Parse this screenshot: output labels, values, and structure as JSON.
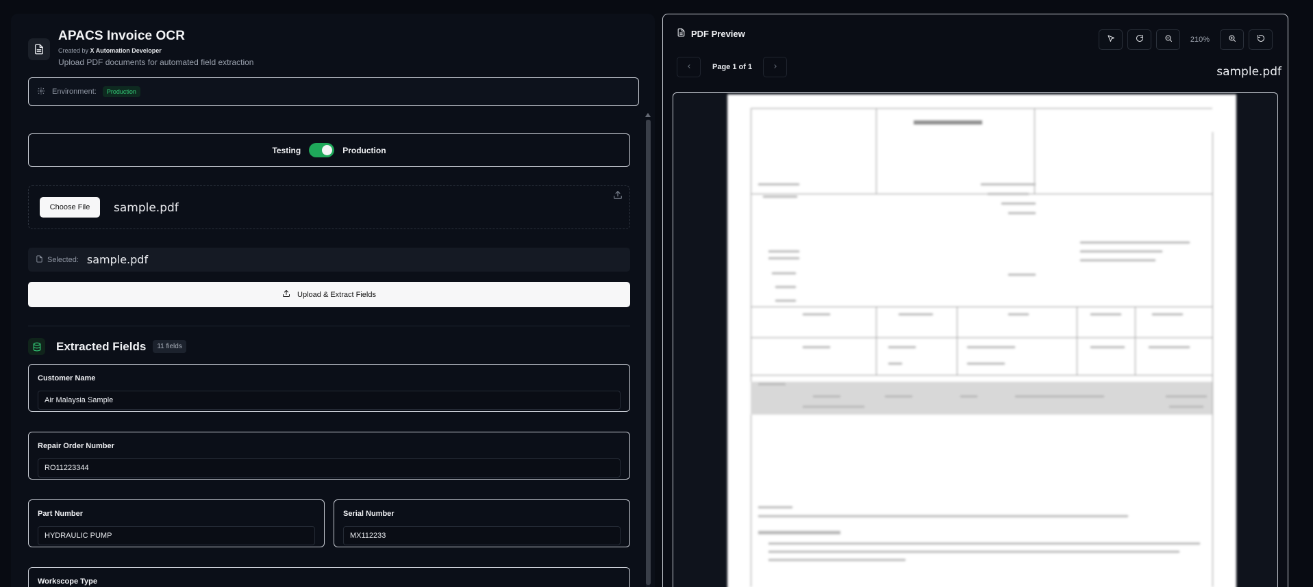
{
  "app": {
    "title": "APACS Invoice OCR",
    "created_prefix": "Created by",
    "created_by": "X Automation Developer",
    "subtitle": "Upload PDF documents for automated field extraction"
  },
  "environment": {
    "label": "Environment:",
    "value": "Production"
  },
  "mode_toggle": {
    "left_label": "Testing",
    "right_label": "Production",
    "state": "Production"
  },
  "upload": {
    "choose_label": "Choose File",
    "file_name": "sample.pdf",
    "selected_label": "Selected:",
    "selected_value": "sample.pdf",
    "extract_label": "Upload & Extract Fields"
  },
  "fields": {
    "title": "Extracted Fields",
    "count": "11 fields",
    "items": [
      {
        "label": "Customer Name",
        "value": "Air Malaysia Sample"
      },
      {
        "label": "Repair Order Number",
        "value": "RO11223344"
      },
      {
        "label": "Part Number",
        "value": "HYDRAULIC PUMP"
      },
      {
        "label": "Serial Number",
        "value": "MX112233"
      },
      {
        "label": "Workscope Type",
        "value": ""
      }
    ]
  },
  "pdf": {
    "title": "PDF Preview",
    "zoom": "210%",
    "page_label": "Page 1 of 1",
    "file_name": "sample.pdf"
  },
  "colors": {
    "accent_green": "#1fa85a",
    "badge_green": "#34d07a",
    "background": "#080b12"
  }
}
